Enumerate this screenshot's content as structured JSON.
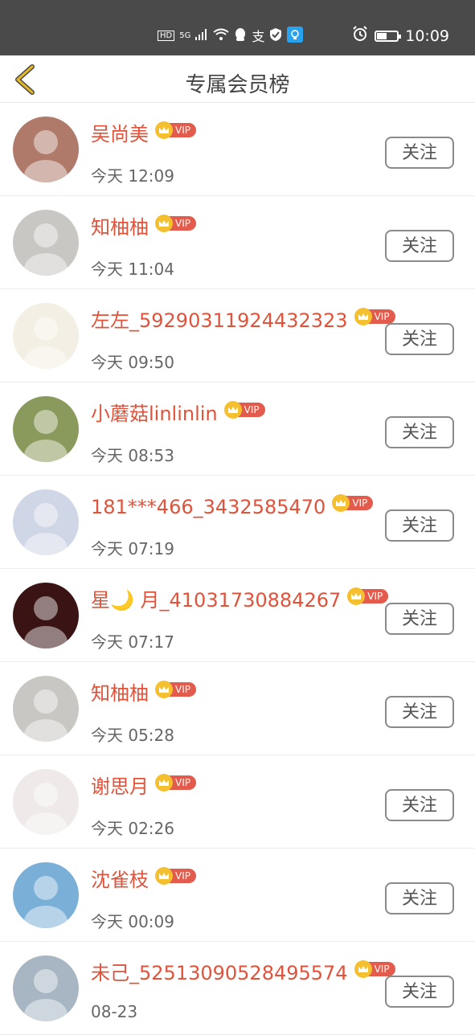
{
  "status_bar": {
    "icons": [
      "HD",
      "5G",
      "signal-icon",
      "wifi-icon",
      "qq-icon",
      "alipay-icon",
      "shield-icon",
      "app-icon"
    ],
    "hd": "HD",
    "network": "5G",
    "time": "10:09"
  },
  "header": {
    "title": "专属会员榜"
  },
  "badge_label": "VIP",
  "follow_label": "关注",
  "members": [
    {
      "name": "吴尚美",
      "time": "今天 12:09",
      "avatar_color": "#b07a6a"
    },
    {
      "name": "知柚柚",
      "time": "今天 11:04",
      "avatar_color": "#c9c7c4"
    },
    {
      "name": "左左_59290311924432323",
      "time": "今天 09:50",
      "avatar_color": "#f4efe4"
    },
    {
      "name": "小蘑菇linlinlin",
      "time": "今天 08:53",
      "avatar_color": "#8a9a5c"
    },
    {
      "name": "181***466_3432585470",
      "time": "今天 07:19",
      "avatar_color": "#cfd6e6"
    },
    {
      "name": "星🌙 月_41031730884267",
      "time": "今天 07:17",
      "avatar_color": "#3a1414"
    },
    {
      "name": "知柚柚",
      "time": "今天 05:28",
      "avatar_color": "#c9c7c4"
    },
    {
      "name": "谢思月",
      "time": "今天 02:26",
      "avatar_color": "#efe9ea"
    },
    {
      "name": "沈雀枝",
      "time": "今天 00:09",
      "avatar_color": "#7ab0d8"
    },
    {
      "name": "未己_52513090528495574",
      "time": "08-23",
      "avatar_color": "#a7b6c2"
    }
  ],
  "colors": {
    "name": "#e0533b",
    "vip": "#e25b4c",
    "crown": "#f5c030",
    "back": "#e7b826"
  }
}
